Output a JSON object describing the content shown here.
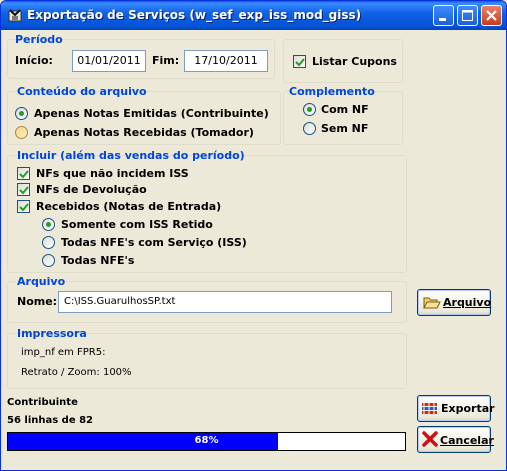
{
  "window": {
    "title": "Exportação de Serviços (w_sef_exp_iss_mod_giss)",
    "controls": [
      "minimize",
      "maximize",
      "close"
    ]
  },
  "periodo": {
    "title": "Período",
    "inicio_label": "Início:",
    "inicio_value": "01/01/2011",
    "fim_label": "Fim:",
    "fim_value": "17/10/2011",
    "listar_cupons_label": "Listar Cupons",
    "listar_cupons_checked": true
  },
  "conteudo": {
    "title": "Conteúdo do arquivo",
    "options": [
      {
        "label": "Apenas Notas Emitidas (Contribuinte)",
        "selected": true
      },
      {
        "label": "Apenas Notas Recebidas (Tomador)",
        "selected": false
      }
    ]
  },
  "complemento": {
    "title": "Complemento",
    "options": [
      {
        "label": "Com NF",
        "selected": true
      },
      {
        "label": "Sem NF",
        "selected": false
      }
    ]
  },
  "incluir": {
    "title": "Incluir (além das vendas do período)",
    "checks": [
      {
        "label": "NFs que não incidem ISS",
        "checked": true
      },
      {
        "label": "NFs de Devolução",
        "checked": true
      },
      {
        "label": "Recebidos (Notas de Entrada)",
        "checked": true
      }
    ],
    "radios": [
      {
        "label": "Somente com ISS Retido",
        "selected": true
      },
      {
        "label": "Todas NFE's com Serviço (ISS)",
        "selected": false
      },
      {
        "label": "Todas NFE's",
        "selected": false
      }
    ]
  },
  "arquivo": {
    "title": "Arquivo",
    "nome_label": "Nome:",
    "nome_value": "C:\\ISS.GuarulhosSP.txt",
    "button_label": "Arquivo",
    "button_icon": "folder-open-icon"
  },
  "impressora": {
    "title": "Impressora",
    "line1": "imp_nf em FPR5:",
    "line2": "Retrato / Zoom: 100%"
  },
  "status": {
    "label": "Contribuinte",
    "count": "56 linhas de 82",
    "progress_percent": 68,
    "progress_text": "68%"
  },
  "buttons": {
    "exportar_label": "Exportar",
    "cancelar_label": "Cancelar"
  },
  "colors": {
    "section_title": "#0046d5",
    "progress_fill": "#0000ff",
    "titlebar": "#0553d6"
  }
}
